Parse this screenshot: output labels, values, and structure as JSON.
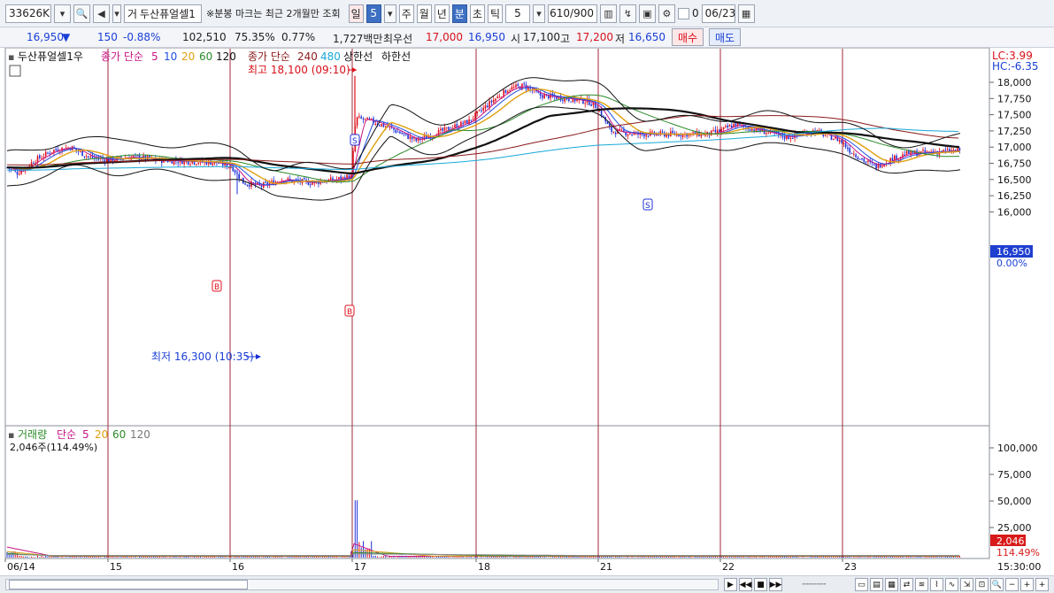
{
  "toolbar": {
    "code": "33626K",
    "name_prefix": "거",
    "stock_name": "두산퓨얼셀1",
    "notice": "※분봉 마크는 최근 2개월만 조회",
    "periods": [
      "일",
      "5",
      "주",
      "월",
      "년",
      "분",
      "초",
      "틱"
    ],
    "active_period": "분",
    "interval": "5",
    "count": "610",
    "count_max": "/900",
    "checkbox_label": "0",
    "date": "06/23"
  },
  "quote": {
    "price": "16,950",
    "arrow": "▼",
    "change": "150",
    "change_pct": "-0.88%",
    "volume": "102,510",
    "volume_pct": "75.35%",
    "turnover_pct": "0.77%",
    "amount": "1,727백만",
    "best_label": "최우선",
    "ask": "17,000",
    "bid": "16,950",
    "open_label": "시",
    "open": "17,100",
    "high_label": "고",
    "high": "17,200",
    "low_label": "저",
    "low": "16,650",
    "buy_label": "매수",
    "sell_label": "매도"
  },
  "price_legend": {
    "name": "두산퓨얼셀1우",
    "close_simple": "종가 단순",
    "ma5": "5",
    "ma10": "10",
    "ma20": "20",
    "ma60": "60",
    "ma120": "120",
    "close_simple2": "종가 단순",
    "ma240": "240",
    "ma480": "480",
    "upper": "상한선",
    "lower": "하한선"
  },
  "annotations": {
    "high": "최고 18,100 (09:10)",
    "low": "최저 16,300 (10:35)",
    "lc": "LC:3.99",
    "hc": "HC:-6.35",
    "buy_mark": "B",
    "sell_mark": "S",
    "current_price": "16,950",
    "current_pct": "0.00%"
  },
  "price_axis": [
    "18,000",
    "17,750",
    "17,500",
    "17,250",
    "17,000",
    "16,750",
    "16,500",
    "16,250",
    "16,000"
  ],
  "volume_legend": {
    "name": "거래량",
    "simple": "단순",
    "ma5": "5",
    "ma20": "20",
    "ma60": "60",
    "ma120": "120",
    "value": "2,046주(114.49%)"
  },
  "volume_axis": [
    "100,000",
    "75,000",
    "50,000",
    "25,000"
  ],
  "volume_current": "2,046",
  "volume_pct": "114.49%",
  "date_axis": [
    "06/14",
    "15",
    "16",
    "17",
    "18",
    "21",
    "22",
    "23"
  ],
  "time_label": "15:30:00",
  "colors": {
    "up": "#e0101c",
    "down": "#1c2fd8",
    "ma5": "#c71585",
    "ma10": "#1f4fe0",
    "ma20": "#e0a010",
    "ma60": "#2a8a2a",
    "ma120": "#111111",
    "ma240": "#8b1a1a",
    "ma480": "#19a8d8",
    "day_line": "#a0283a"
  }
}
